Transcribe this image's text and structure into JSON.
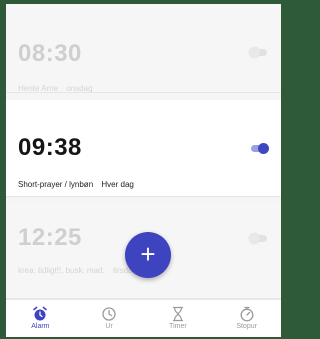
{
  "alarms": [
    {
      "time": "08:30",
      "label": "Hente Arne",
      "repeat": "onsdag",
      "enabled": false
    },
    {
      "time": "09:38",
      "label": "Short-prayer / lynbøn",
      "repeat": "Hver dag",
      "enabled": true
    },
    {
      "time": "12:25",
      "label": "krea: tidligt!!, busk, mad.",
      "repeat": "tirsdag",
      "enabled": false
    }
  ],
  "fab": {
    "symbol": "+"
  },
  "nav": {
    "alarm": "Alarm",
    "clock": "Ur",
    "timer": "Timer",
    "stopwatch": "Stopur"
  },
  "colors": {
    "accent": "#3e43bf",
    "background": "#f5f5f5"
  },
  "icons": [
    "alarm-clock-icon",
    "clock-icon",
    "hourglass-icon",
    "stopwatch-icon",
    "plus-icon"
  ]
}
